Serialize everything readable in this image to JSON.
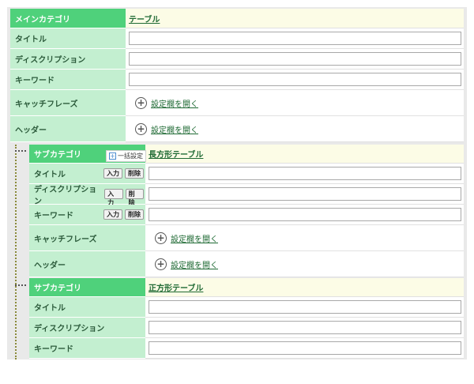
{
  "main": {
    "category_label": "メインカテゴリ",
    "category_value": "テーブル",
    "title_label": "タイトル",
    "description_label": "ディスクリプション",
    "keyword_label": "キーワード",
    "catchphrase_label": "キャッチフレーズ",
    "header_label": "ヘッダー",
    "open_settings": "設定欄を開く"
  },
  "sub1": {
    "category_label": "サブカテゴリ",
    "bulk_label": "一括設定",
    "category_value": "長方形テーブル",
    "title_label": "タイトル",
    "description_label": "ディスクリプション",
    "keyword_label": "キーワード",
    "catchphrase_label": "キャッチフレーズ",
    "header_label": "ヘッダー",
    "input_btn": "入力",
    "delete_btn": "削除",
    "open_settings": "設定欄を開く"
  },
  "sub2": {
    "category_label": "サブカテゴリ",
    "category_value": "正方形テーブル",
    "title_label": "タイトル",
    "description_label": "ディスクリプション",
    "keyword_label": "キーワード"
  },
  "icons": {
    "plus": "+",
    "bulk": "+"
  }
}
